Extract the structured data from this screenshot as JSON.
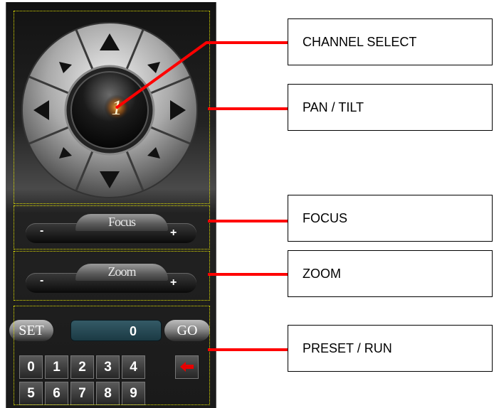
{
  "callouts": {
    "channel_select": "CHANNEL SELECT",
    "pan_tilt": "PAN / TILT",
    "focus": "FOCUS",
    "zoom": "ZOOM",
    "preset_run": "PRESET / RUN"
  },
  "controller": {
    "channel_digit": "1",
    "focus_label": "Focus",
    "zoom_label": "Zoom",
    "minus": "-",
    "plus": "+",
    "set_label": "SET",
    "go_label": "GO",
    "preset_value": "0",
    "keys_row1": [
      "0",
      "1",
      "2",
      "3",
      "4"
    ],
    "keys_row2": [
      "5",
      "6",
      "7",
      "8",
      "9"
    ],
    "back_icon": "left-arrow-icon"
  },
  "colors": {
    "leader": "#ff0000",
    "dotted_outline": "#e6e600",
    "display": "#1b3a44",
    "channel_glow": "#ffa030"
  }
}
